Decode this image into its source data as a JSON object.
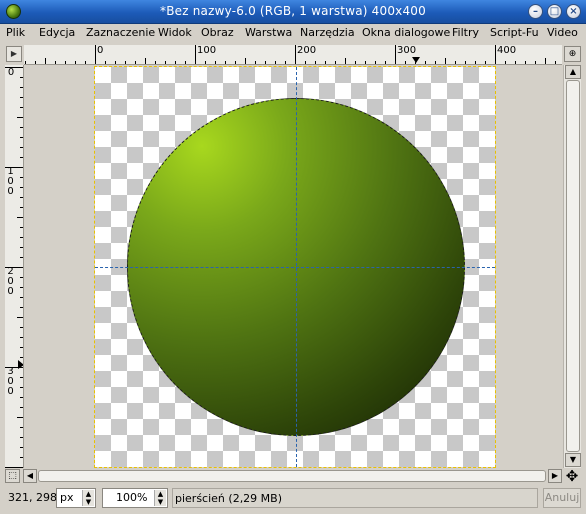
{
  "window": {
    "title": "*Bez nazwy-6.0 (RGB, 1 warstwa) 400x400",
    "icon": "gimp-app-icon",
    "controls": {
      "minimize": "–",
      "maximize": "□",
      "close": "×"
    }
  },
  "menu": [
    "Plik",
    "Edycja",
    "Zaznaczenie",
    "Widok",
    "Obraz",
    "Warstwa",
    "Narzędzia",
    "Okna dialogowe",
    "Filtry",
    "Script-Fu",
    "Video"
  ],
  "rulers": {
    "horizontal": [
      "0",
      "100",
      "200",
      "300",
      "400"
    ],
    "vertical": [
      "0",
      "100",
      "200",
      "300"
    ]
  },
  "canvas": {
    "image_width": 400,
    "image_height": 400,
    "ball_gradient": [
      "#a8d81e",
      "#4f7312",
      "#111a02"
    ],
    "guide_color": "#2a63ad"
  },
  "statusbar": {
    "coords": "321, 298",
    "unit": "px",
    "zoom": "100%",
    "message": "pierścień (2,29 MB)",
    "cancel_label": "Anuluj"
  }
}
